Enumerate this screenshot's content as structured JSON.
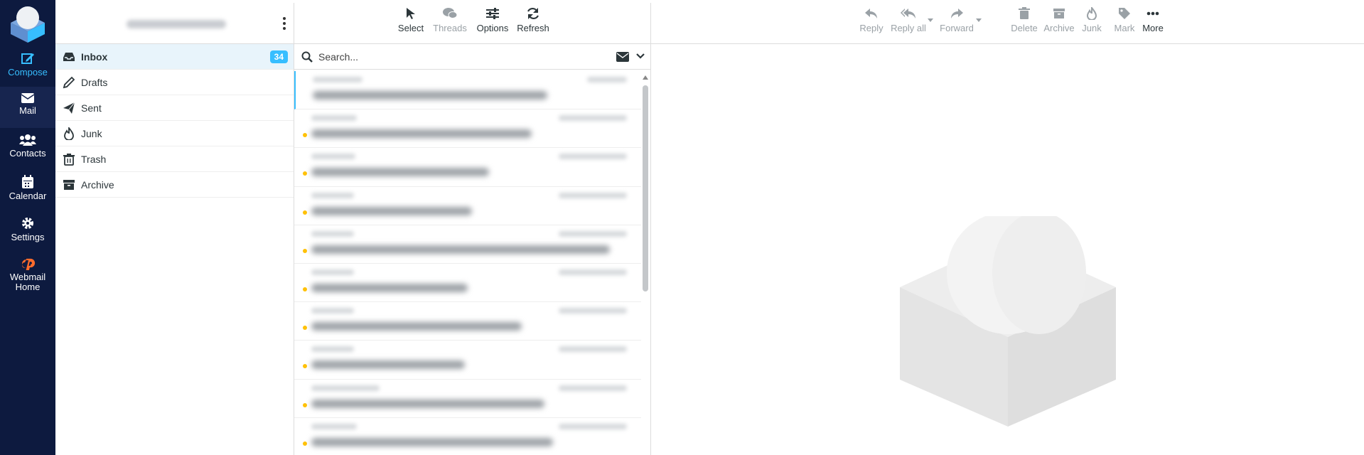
{
  "nav": {
    "compose": "Compose",
    "mail": "Mail",
    "contacts": "Contacts",
    "calendar": "Calendar",
    "settings": "Settings",
    "webmail_home_1": "Webmail",
    "webmail_home_2": "Home"
  },
  "folders": [
    {
      "label": "Inbox",
      "unread": "34",
      "icon": "inbox-icon"
    },
    {
      "label": "Drafts",
      "icon": "pencil-icon"
    },
    {
      "label": "Sent",
      "icon": "paper-plane-icon"
    },
    {
      "label": "Junk",
      "icon": "fire-icon"
    },
    {
      "label": "Trash",
      "icon": "trash-icon"
    },
    {
      "label": "Archive",
      "icon": "archive-icon"
    }
  ],
  "list_toolbar": {
    "select": "Select",
    "threads": "Threads",
    "options": "Options",
    "refresh": "Refresh"
  },
  "search": {
    "placeholder": "Search..."
  },
  "reader_toolbar": {
    "reply": "Reply",
    "reply_all": "Reply all",
    "forward": "Forward",
    "delete": "Delete",
    "archive": "Archive",
    "junk": "Junk",
    "mark": "Mark",
    "more": "More"
  },
  "colors": {
    "nav_bg": "#0d1a3f",
    "accent": "#37beff",
    "unread_dot": "#ffc107"
  }
}
